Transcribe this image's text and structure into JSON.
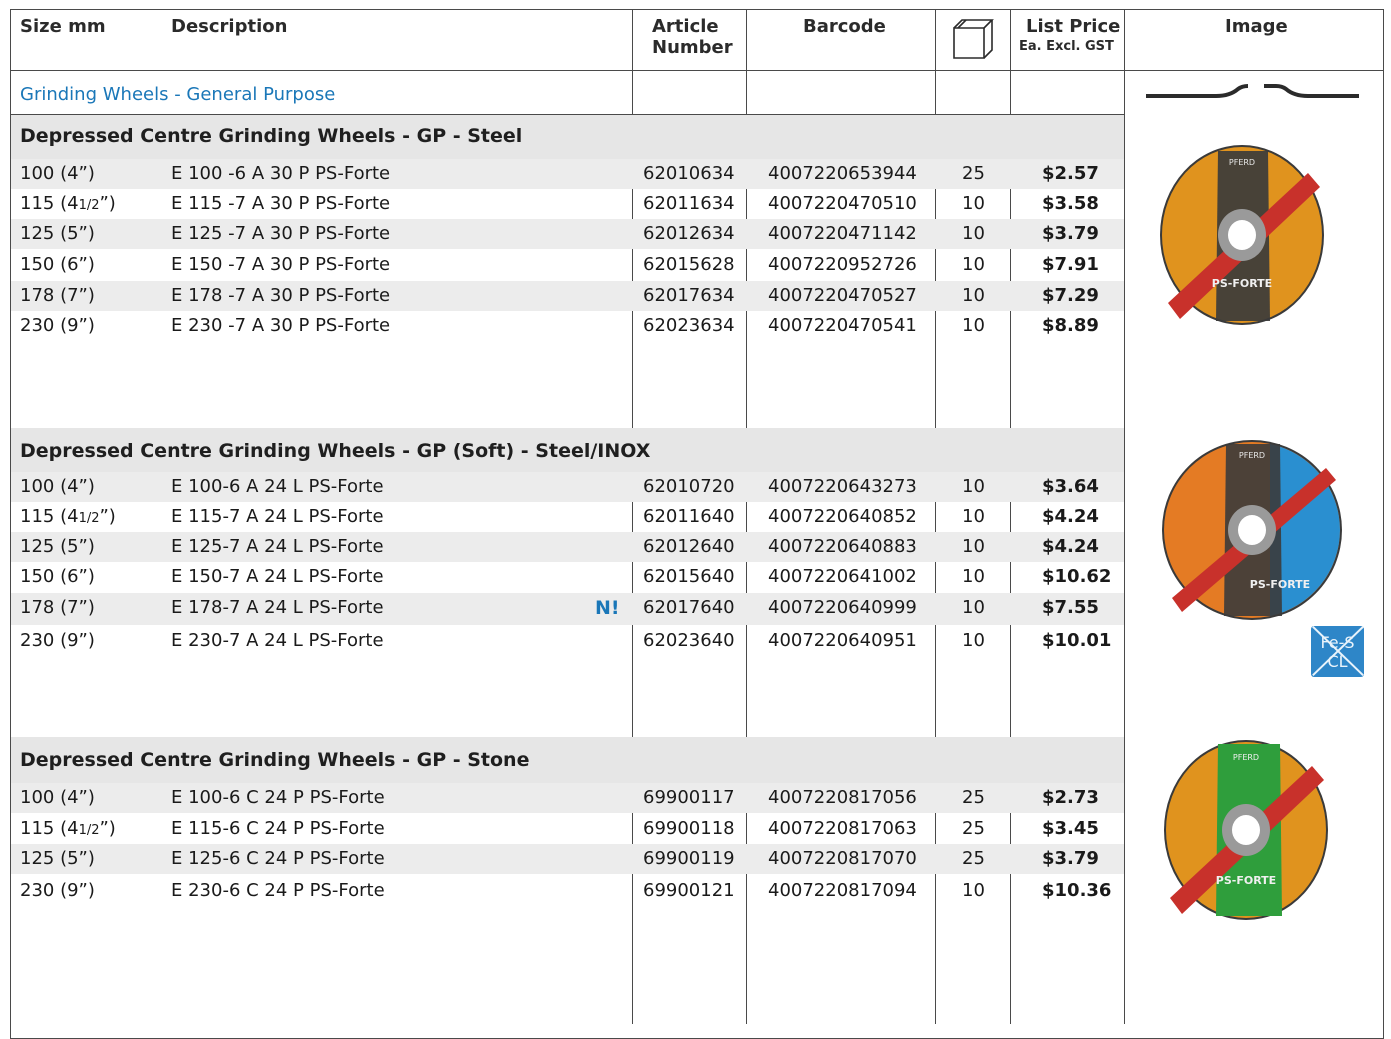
{
  "header": {
    "size": "Size mm",
    "description": "Description",
    "article_1": "Article",
    "article_2": "Number",
    "barcode": "Barcode",
    "pack_icon": "box-icon",
    "price_1": "List Price",
    "price_2": "Ea. Excl. GST",
    "image": "Image"
  },
  "category": "Grinding Wheels - General Purpose",
  "sections": [
    {
      "title": "Depressed Centre Grinding Wheels - GP - Steel",
      "rows": [
        {
          "size": "100 (4”)",
          "desc": "E 100 -6 A 30 P PS-Forte",
          "article": "62010634",
          "barcode": "4007220653944",
          "qty": "25",
          "price": "$2.57"
        },
        {
          "size": "115 (4",
          "size_frac": "1/2",
          "size_end": "”)",
          "desc": "E 115 -7 A 30 P PS-Forte",
          "article": "62011634",
          "barcode": "4007220470510",
          "qty": "10",
          "price": "$3.58"
        },
        {
          "size": "125 (5”)",
          "desc": "E 125 -7 A 30 P PS-Forte",
          "article": "62012634",
          "barcode": "4007220471142",
          "qty": "10",
          "price": "$3.79"
        },
        {
          "size": "150 (6”)",
          "desc": "E 150 -7 A 30 P PS-Forte",
          "article": "62015628",
          "barcode": "4007220952726",
          "qty": "10",
          "price": "$7.91"
        },
        {
          "size": "178 (7”)",
          "desc": "E 178 -7 A 30 P PS-Forte",
          "article": "62017634",
          "barcode": "4007220470527",
          "qty": "10",
          "price": "$7.29"
        },
        {
          "size": "230 (9”)",
          "desc": "E 230 -7 A 30 P PS-Forte",
          "article": "62023634",
          "barcode": "4007220470541",
          "qty": "10",
          "price": "$8.89"
        }
      ]
    },
    {
      "title": "Depressed Centre Grinding Wheels - GP (Soft) - Steel/INOX",
      "rows": [
        {
          "size": "100 (4”)",
          "desc": "E 100-6 A 24 L PS-Forte",
          "article": "62010720",
          "barcode": "4007220643273",
          "qty": "10",
          "price": "$3.64"
        },
        {
          "size": "115 (4",
          "size_frac": "1/2",
          "size_end": "”)",
          "desc": "E 115-7 A 24 L PS-Forte",
          "article": "62011640",
          "barcode": "4007220640852",
          "qty": "10",
          "price": "$4.24"
        },
        {
          "size": "125 (5”)",
          "desc": "E 125-7 A 24 L PS-Forte",
          "article": "62012640",
          "barcode": "4007220640883",
          "qty": "10",
          "price": "$4.24"
        },
        {
          "size": "150 (6”)",
          "desc": "E 150-7 A 24 L PS-Forte",
          "article": "62015640",
          "barcode": "4007220641002",
          "qty": "10",
          "price": "$10.62"
        },
        {
          "size": "178 (7”)",
          "desc": "E 178-7 A 24 L PS-Forte",
          "new_flag": "N!",
          "article": "62017640",
          "barcode": "4007220640999",
          "qty": "10",
          "price": "$7.55"
        },
        {
          "size": "230 (9”)",
          "desc": "E 230-7 A 24 L PS-Forte",
          "article": "62023640",
          "barcode": "4007220640951",
          "qty": "10",
          "price": "$10.01"
        }
      ]
    },
    {
      "title": "Depressed Centre Grinding Wheels - GP - Stone",
      "rows": [
        {
          "size": "100 (4”)",
          "desc": "E 100-6 C 24 P PS-Forte",
          "article": "69900117",
          "barcode": "4007220817056",
          "qty": "25",
          "price": "$2.73"
        },
        {
          "size": "115 (4",
          "size_frac": "1/2",
          "size_end": "”)",
          "desc": "E 115-6 C 24 P PS-Forte",
          "article": "69900118",
          "barcode": "4007220817063",
          "qty": "25",
          "price": "$3.45"
        },
        {
          "size": "125 (5”)",
          "desc": "E 125-6 C 24 P PS-Forte",
          "article": "69900119",
          "barcode": "4007220817070",
          "qty": "25",
          "price": "$3.79"
        },
        {
          "size": "230 (9”)",
          "desc": "E 230-6 C 24 P PS-Forte",
          "article": "69900121",
          "barcode": "4007220817094",
          "qty": "10",
          "price": "$10.36"
        }
      ]
    }
  ],
  "images": {
    "wheel_label": "PS-FORTE",
    "brand": "PFERD",
    "badge_line1": "Fe-S",
    "badge_line2": "CL",
    "colors": {
      "steel": "#e0931e",
      "inox_orange": "#e47b24",
      "inox_blue": "#2a8fd0",
      "stone_green": "#2f9e3c",
      "accent": "#1a77b8"
    }
  }
}
